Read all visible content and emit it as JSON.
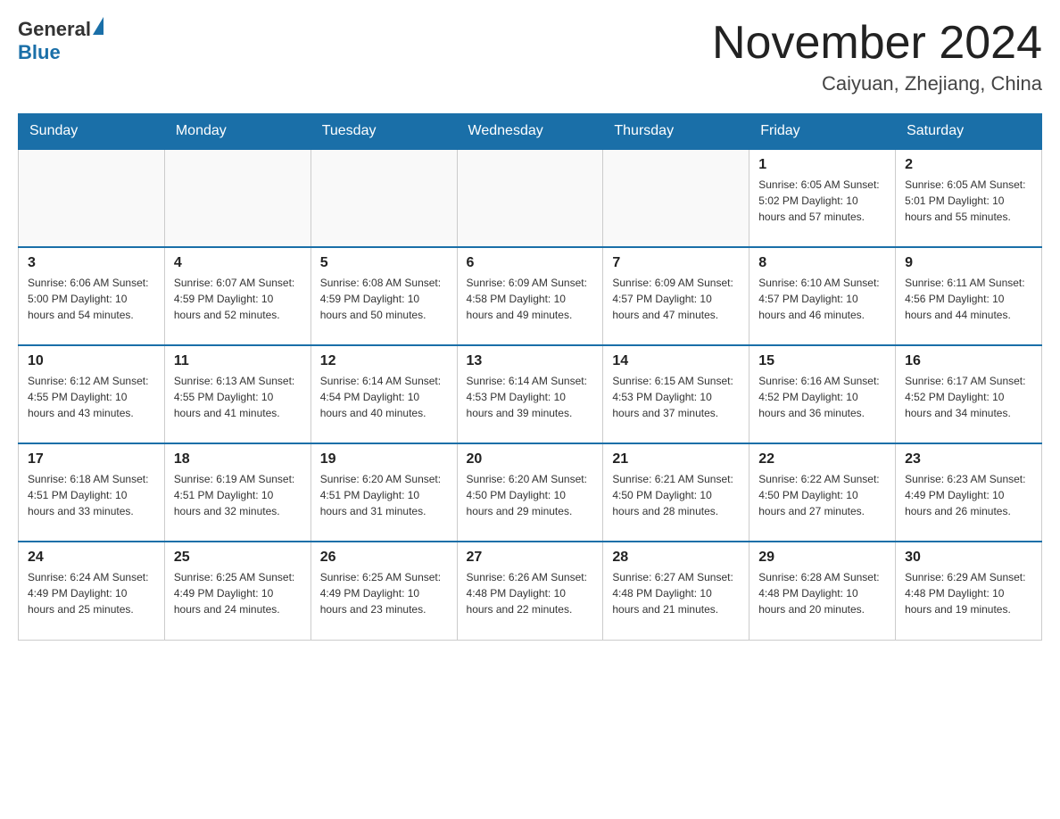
{
  "header": {
    "logo_general": "General",
    "logo_blue": "Blue",
    "title": "November 2024",
    "subtitle": "Caiyuan, Zhejiang, China"
  },
  "days_of_week": [
    "Sunday",
    "Monday",
    "Tuesday",
    "Wednesday",
    "Thursday",
    "Friday",
    "Saturday"
  ],
  "weeks": [
    [
      {
        "day": "",
        "info": ""
      },
      {
        "day": "",
        "info": ""
      },
      {
        "day": "",
        "info": ""
      },
      {
        "day": "",
        "info": ""
      },
      {
        "day": "",
        "info": ""
      },
      {
        "day": "1",
        "info": "Sunrise: 6:05 AM\nSunset: 5:02 PM\nDaylight: 10 hours\nand 57 minutes."
      },
      {
        "day": "2",
        "info": "Sunrise: 6:05 AM\nSunset: 5:01 PM\nDaylight: 10 hours\nand 55 minutes."
      }
    ],
    [
      {
        "day": "3",
        "info": "Sunrise: 6:06 AM\nSunset: 5:00 PM\nDaylight: 10 hours\nand 54 minutes."
      },
      {
        "day": "4",
        "info": "Sunrise: 6:07 AM\nSunset: 4:59 PM\nDaylight: 10 hours\nand 52 minutes."
      },
      {
        "day": "5",
        "info": "Sunrise: 6:08 AM\nSunset: 4:59 PM\nDaylight: 10 hours\nand 50 minutes."
      },
      {
        "day": "6",
        "info": "Sunrise: 6:09 AM\nSunset: 4:58 PM\nDaylight: 10 hours\nand 49 minutes."
      },
      {
        "day": "7",
        "info": "Sunrise: 6:09 AM\nSunset: 4:57 PM\nDaylight: 10 hours\nand 47 minutes."
      },
      {
        "day": "8",
        "info": "Sunrise: 6:10 AM\nSunset: 4:57 PM\nDaylight: 10 hours\nand 46 minutes."
      },
      {
        "day": "9",
        "info": "Sunrise: 6:11 AM\nSunset: 4:56 PM\nDaylight: 10 hours\nand 44 minutes."
      }
    ],
    [
      {
        "day": "10",
        "info": "Sunrise: 6:12 AM\nSunset: 4:55 PM\nDaylight: 10 hours\nand 43 minutes."
      },
      {
        "day": "11",
        "info": "Sunrise: 6:13 AM\nSunset: 4:55 PM\nDaylight: 10 hours\nand 41 minutes."
      },
      {
        "day": "12",
        "info": "Sunrise: 6:14 AM\nSunset: 4:54 PM\nDaylight: 10 hours\nand 40 minutes."
      },
      {
        "day": "13",
        "info": "Sunrise: 6:14 AM\nSunset: 4:53 PM\nDaylight: 10 hours\nand 39 minutes."
      },
      {
        "day": "14",
        "info": "Sunrise: 6:15 AM\nSunset: 4:53 PM\nDaylight: 10 hours\nand 37 minutes."
      },
      {
        "day": "15",
        "info": "Sunrise: 6:16 AM\nSunset: 4:52 PM\nDaylight: 10 hours\nand 36 minutes."
      },
      {
        "day": "16",
        "info": "Sunrise: 6:17 AM\nSunset: 4:52 PM\nDaylight: 10 hours\nand 34 minutes."
      }
    ],
    [
      {
        "day": "17",
        "info": "Sunrise: 6:18 AM\nSunset: 4:51 PM\nDaylight: 10 hours\nand 33 minutes."
      },
      {
        "day": "18",
        "info": "Sunrise: 6:19 AM\nSunset: 4:51 PM\nDaylight: 10 hours\nand 32 minutes."
      },
      {
        "day": "19",
        "info": "Sunrise: 6:20 AM\nSunset: 4:51 PM\nDaylight: 10 hours\nand 31 minutes."
      },
      {
        "day": "20",
        "info": "Sunrise: 6:20 AM\nSunset: 4:50 PM\nDaylight: 10 hours\nand 29 minutes."
      },
      {
        "day": "21",
        "info": "Sunrise: 6:21 AM\nSunset: 4:50 PM\nDaylight: 10 hours\nand 28 minutes."
      },
      {
        "day": "22",
        "info": "Sunrise: 6:22 AM\nSunset: 4:50 PM\nDaylight: 10 hours\nand 27 minutes."
      },
      {
        "day": "23",
        "info": "Sunrise: 6:23 AM\nSunset: 4:49 PM\nDaylight: 10 hours\nand 26 minutes."
      }
    ],
    [
      {
        "day": "24",
        "info": "Sunrise: 6:24 AM\nSunset: 4:49 PM\nDaylight: 10 hours\nand 25 minutes."
      },
      {
        "day": "25",
        "info": "Sunrise: 6:25 AM\nSunset: 4:49 PM\nDaylight: 10 hours\nand 24 minutes."
      },
      {
        "day": "26",
        "info": "Sunrise: 6:25 AM\nSunset: 4:49 PM\nDaylight: 10 hours\nand 23 minutes."
      },
      {
        "day": "27",
        "info": "Sunrise: 6:26 AM\nSunset: 4:48 PM\nDaylight: 10 hours\nand 22 minutes."
      },
      {
        "day": "28",
        "info": "Sunrise: 6:27 AM\nSunset: 4:48 PM\nDaylight: 10 hours\nand 21 minutes."
      },
      {
        "day": "29",
        "info": "Sunrise: 6:28 AM\nSunset: 4:48 PM\nDaylight: 10 hours\nand 20 minutes."
      },
      {
        "day": "30",
        "info": "Sunrise: 6:29 AM\nSunset: 4:48 PM\nDaylight: 10 hours\nand 19 minutes."
      }
    ]
  ]
}
